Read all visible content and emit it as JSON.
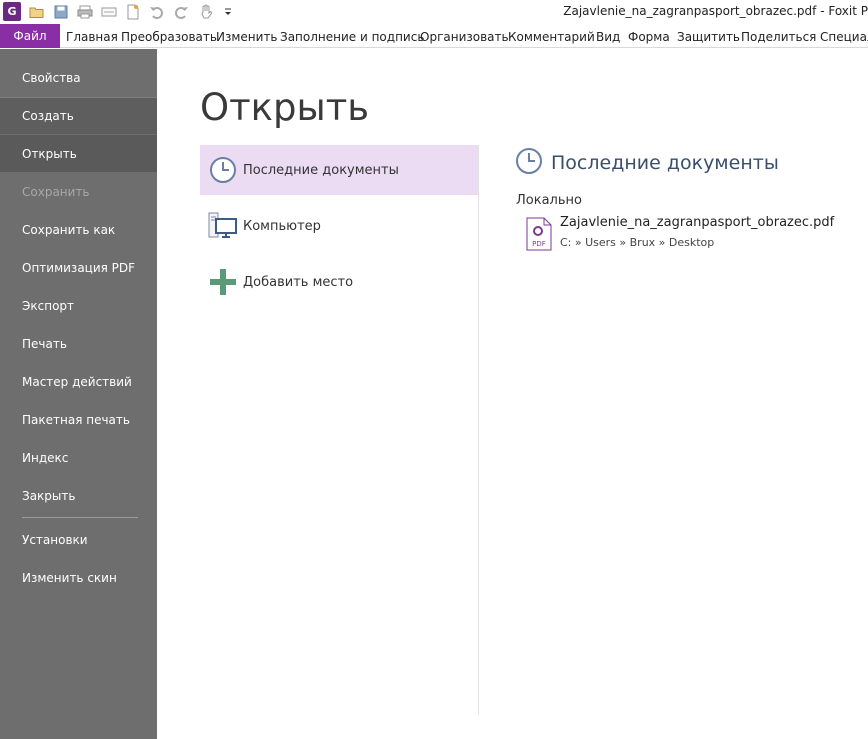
{
  "window": {
    "title": "Zajavlenie_na_zagranpasport_obrazec.pdf - Foxit P"
  },
  "quick_access": [
    "app-logo",
    "open-folder-icon",
    "save-icon",
    "print-icon",
    "scan-icon",
    "new-icon",
    "undo-icon",
    "redo-icon",
    "hand-tool-icon",
    "customize-dropdown-icon"
  ],
  "ribbon": {
    "file_tab": "Файл",
    "tabs": [
      "Главная",
      "Преобразовать",
      "Изменить",
      "Заполнение и подпись",
      "Организовать",
      "Комментарий",
      "Вид",
      "Форма",
      "Защитить",
      "Поделиться",
      "Специал"
    ]
  },
  "sidebar": {
    "items": [
      {
        "label": "Свойства"
      },
      {
        "label": "Создать"
      },
      {
        "label": "Открыть"
      },
      {
        "label": "Сохранить"
      },
      {
        "label": "Сохранить как"
      },
      {
        "label": "Оптимизация PDF"
      },
      {
        "label": "Экспорт"
      },
      {
        "label": "Печать"
      },
      {
        "label": "Мастер действий"
      },
      {
        "label": "Пакетная печать"
      },
      {
        "label": "Индекс"
      },
      {
        "label": "Закрыть"
      },
      {
        "label": "Установки"
      },
      {
        "label": "Изменить скин"
      }
    ],
    "active": "Открыть",
    "disabled": "Сохранить"
  },
  "main": {
    "title": "Открыть",
    "places": [
      {
        "label": "Последние документы",
        "icon": "clock-icon"
      },
      {
        "label": "Компьютер",
        "icon": "computer-icon"
      },
      {
        "label": "Добавить место",
        "icon": "plus-icon"
      }
    ],
    "recent": {
      "heading": "Последние документы",
      "group_label": "Локально",
      "files": [
        {
          "name": "Zajavlenie_na_zagranpasport_obrazec.pdf",
          "path": "C: » Users » Brux » Desktop",
          "icon_label": "PDF"
        }
      ]
    }
  },
  "colors": {
    "file_tab": "#8a2ea5",
    "sidebar_bg": "#6e6e6e",
    "sidebar_active": "#5a5a5a",
    "selected_place": "#ecdcf3",
    "heading_blue": "#3b4f6b"
  }
}
